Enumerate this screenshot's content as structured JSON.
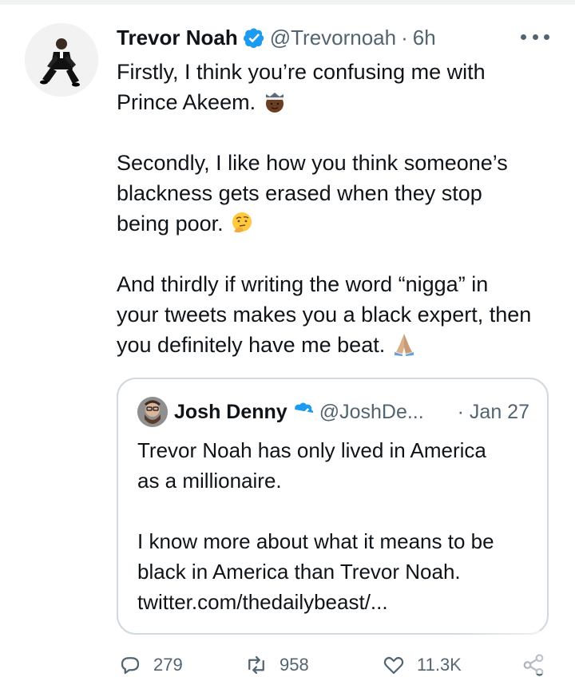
{
  "tweet": {
    "author_name": "Trevor Noah",
    "author_handle": "@Trevornoah",
    "separator": "·",
    "time": "6h",
    "text_line1": "Firstly, I think you’re confusing me with",
    "text_line2": "Prince Akeem. ",
    "text_para2": "Secondly, I like how you think someone’s\nblackness gets erased when they stop\nbeing poor. ",
    "text_para3": "And thirdly if writing the word “nigga” in\nyour tweets makes you a black expert, then\nyou definitely have me beat. ",
    "emojis": [
      "crowned-face-emoji",
      "thinking-face-emoji",
      "folded-hands-emoji"
    ]
  },
  "quoted_tweet": {
    "author_name": "Josh Denny",
    "author_handle": "@JoshDe...",
    "date": "· Jan 27",
    "text": "Trevor Noah has only lived in America\nas a millionaire.\n\nI know more about what it means to be\nblack in America than Trevor Noah.\ntwitter.com/thedailybeast/..."
  },
  "actions": {
    "replies": "279",
    "retweets": "958",
    "likes": "11.3K"
  },
  "colors": {
    "verified": "#1d9bf0",
    "secondary_text": "#536471",
    "border": "#cfd9de"
  }
}
